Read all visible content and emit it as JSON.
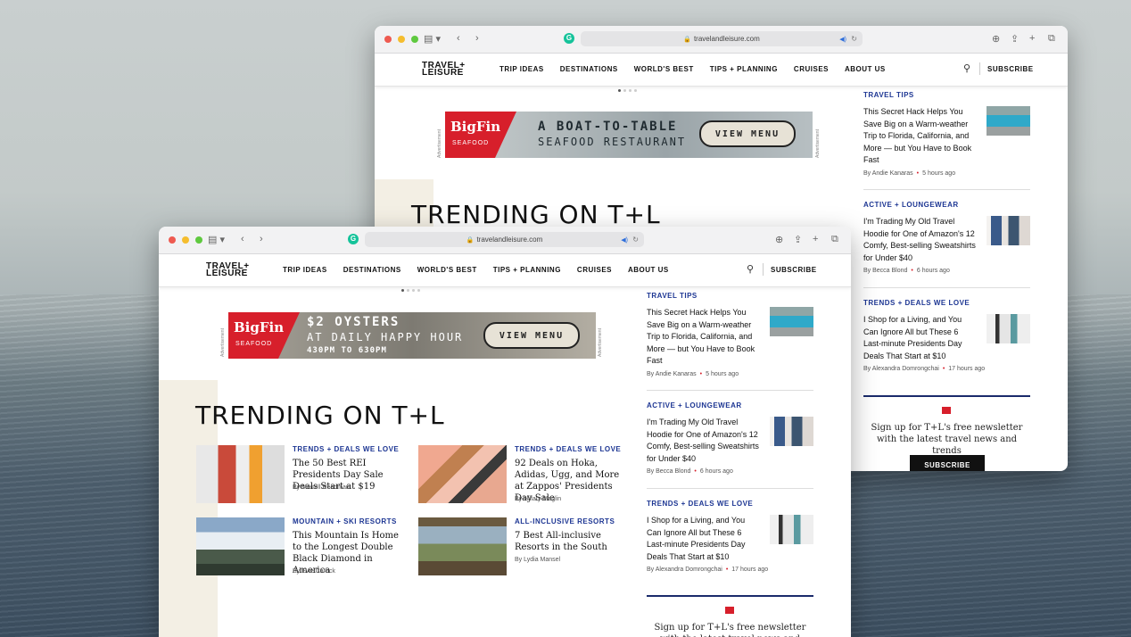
{
  "url": "travelandleisure.com",
  "logo": {
    "line1": "TRAVEL+",
    "line2": "LEISURE"
  },
  "nav": [
    "TRIP IDEAS",
    "DESTINATIONS",
    "WORLD'S BEST",
    "TIPS + PLANNING",
    "CRUISES",
    "ABOUT US"
  ],
  "subscribe": "SUBSCRIBE",
  "ad_label": "Advertisement",
  "ad_brand": {
    "big": "BigFin",
    "small": "SEAFOOD"
  },
  "ad_back": {
    "line1": "A BOAT-TO-TABLE",
    "line2": "SEAFOOD RESTAURANT",
    "button": "VIEW MENU"
  },
  "ad_front": {
    "line1": "$2 OYSTERS",
    "line2": "AT DAILY HAPPY HOUR",
    "line3": "430PM TO 630PM",
    "button": "VIEW MENU"
  },
  "trending_title": "TRENDING ON T+L",
  "cards": [
    {
      "category": "TRENDS + DEALS WE LOVE",
      "title": "The 50 Best REI Presidents Day Sale Deals Start at $19",
      "byline": "By Merrell Readman"
    },
    {
      "category": "TRENDS + DEALS WE LOVE",
      "title": "92 Deals on Hoka, Adidas, Ugg, and More at Zappos' Presidents Day Sale",
      "byline": "By Hillary Maglin"
    },
    {
      "category": "MOUNTAIN + SKI RESORTS",
      "title": "This Mountain Is Home to the Longest Double Black Diamond in America",
      "byline": "By Evie Carrick"
    },
    {
      "category": "ALL-INCLUSIVE RESORTS",
      "title": "7 Best All-inclusive Resorts in the South",
      "byline": "By Lydia Mansel"
    }
  ],
  "sidebar": [
    {
      "category": "TRAVEL TIPS",
      "title": "This Secret Hack Helps You Save Big on a Warm-weather Trip to Florida, California, and More — but You Have to Book Fast",
      "author": "By Andie Kanaras",
      "time": "5 hours ago"
    },
    {
      "category": "ACTIVE + LOUNGEWEAR",
      "title": "I'm Trading My Old Travel Hoodie for One of Amazon's 12 Comfy, Best-selling Sweatshirts for Under $40",
      "author": "By Becca Blond",
      "time": "6 hours ago"
    },
    {
      "category": "TRENDS + DEALS WE LOVE",
      "title": "I Shop for a Living, and You Can Ignore All but These 6 Last-minute Presidents Day Deals That Start at $10",
      "author": "By Alexandra Domrongchai",
      "time": "17 hours ago"
    }
  ],
  "newsletter": {
    "text": "Sign up for T+L's free newsletter with the latest travel news and trends",
    "button": "SUBSCRIBE"
  },
  "colors": {
    "accent_blue": "#1d3693",
    "brand_red": "#d71f2b"
  }
}
